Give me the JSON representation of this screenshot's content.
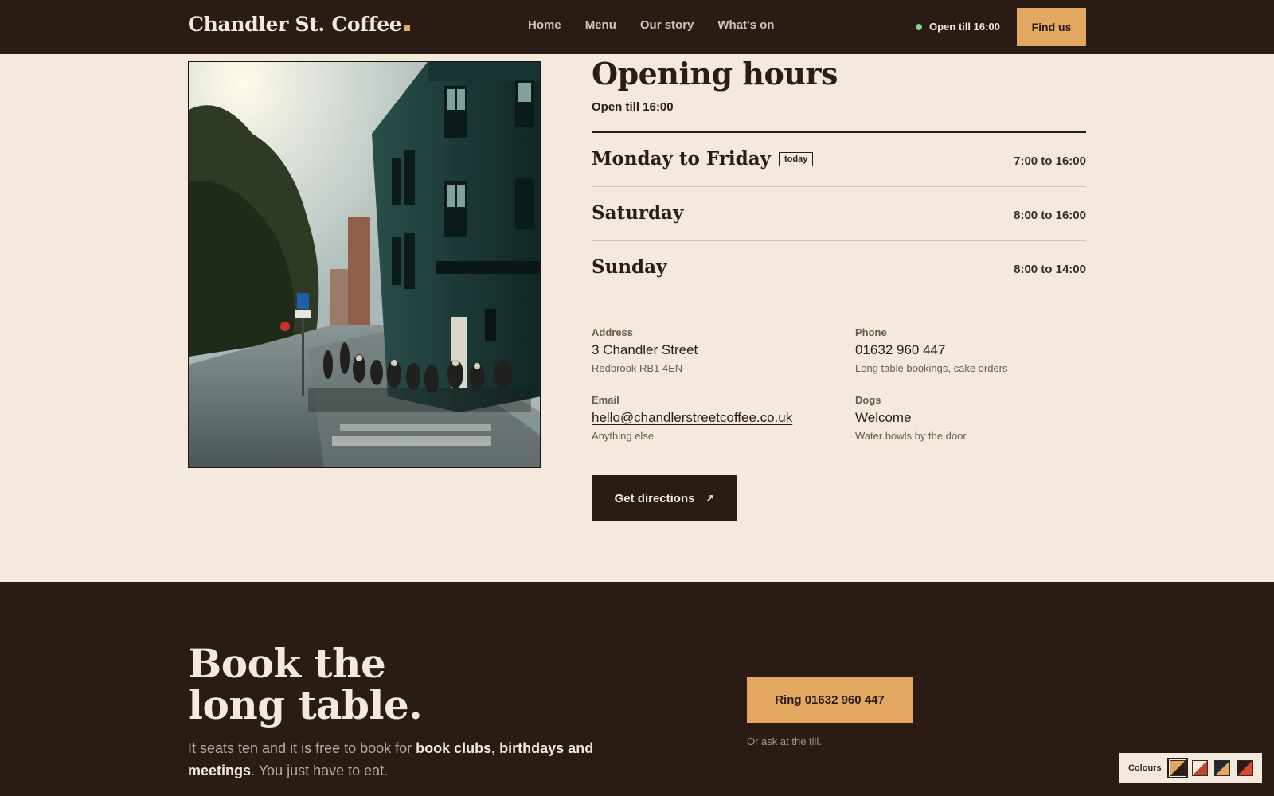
{
  "header": {
    "logo": "Chandler St. Coffee",
    "nav": [
      "Home",
      "Menu",
      "Our story",
      "What's on"
    ],
    "status": "Open till 16:00",
    "cta": "Find us"
  },
  "hours": {
    "title": "Opening hours",
    "subtitle": "Open till 16:00",
    "today_badge": "today",
    "rows": [
      {
        "day": "Monday to Friday",
        "time": "7:00 to 16:00"
      },
      {
        "day": "Saturday",
        "time": "8:00 to 16:00"
      },
      {
        "day": "Sunday",
        "time": "8:00 to 14:00"
      }
    ]
  },
  "contact": {
    "address": {
      "label": "Address",
      "value": "3 Chandler Street",
      "note": "Redbrook RB1 4EN"
    },
    "phone": {
      "label": "Phone",
      "value": "01632 960 447",
      "note": "Long table bookings, cake orders"
    },
    "email": {
      "label": "Email",
      "value": "hello@chandlerstreetcoffee.co.uk",
      "note": "Anything else"
    },
    "dogs": {
      "label": "Dogs",
      "value": "Welcome",
      "note": "Water bowls by the door"
    }
  },
  "directions_label": "Get directions",
  "booking": {
    "title_line1": "Book the",
    "title_line2": "long table.",
    "text_start": "It seats ten and it is free to book for ",
    "text_bold": "book clubs, birthdays and meetings",
    "text_end": ". You just have to eat.",
    "cta": "Ring 01632 960 447",
    "note": "Or ask at the till."
  },
  "colours": {
    "label": "Colours",
    "swatches": [
      {
        "a": "#e2a862",
        "b": "#2a1c15"
      },
      {
        "a": "#f3e9dc",
        "b": "#c0442c"
      },
      {
        "a": "#1f2a33",
        "b": "#e2a862"
      },
      {
        "a": "#2a1c15",
        "b": "#d8472e"
      }
    ]
  },
  "colors": {
    "background": "#f3e9dc",
    "dark": "#2a1c15",
    "accent": "#e2a862",
    "status": "#7ed18a"
  }
}
